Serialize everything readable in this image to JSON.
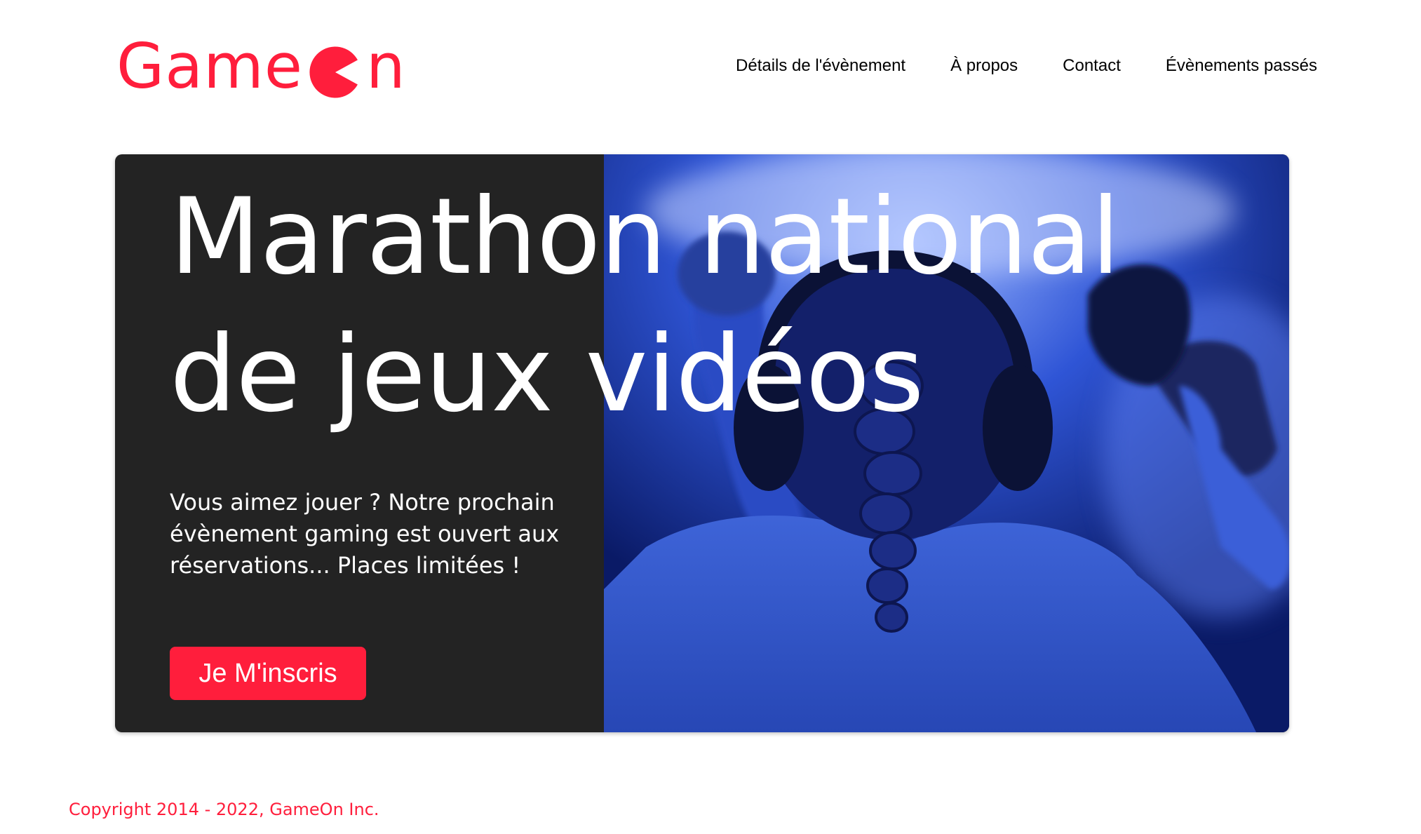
{
  "brand": {
    "name_before": "Game",
    "name_after": "n",
    "logo_icon": "pacman-o-icon",
    "color": "#ff1e3c"
  },
  "nav": {
    "items": [
      {
        "label": "Détails de l'évènement"
      },
      {
        "label": "À propos"
      },
      {
        "label": "Contact"
      },
      {
        "label": "Évènements passés"
      }
    ]
  },
  "hero": {
    "title": "Marathon national de jeux vidéos",
    "text": "Vous aimez jouer ? Notre prochain évènement gaming est ouvert aux réservations... Places limitées !",
    "cta_label": "Je M'inscris",
    "panel_color": "#232323",
    "image_icon": "gamer-photo-icon"
  },
  "footer": {
    "copyright": "Copyright 2014 - 2022, GameOn Inc."
  }
}
